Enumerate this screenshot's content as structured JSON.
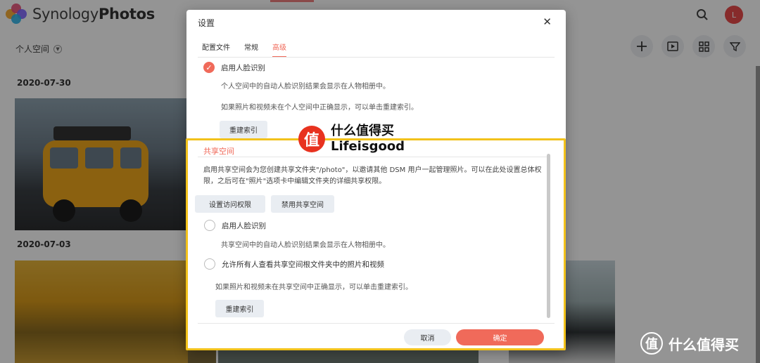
{
  "app": {
    "logo_text_light": "Synology",
    "logo_text_bold": "Photos",
    "space_selector": "个人空间",
    "avatar_letter": "L",
    "dates": [
      "2020-07-30",
      "2020-07-03"
    ],
    "icons": {
      "search": "search-icon",
      "add": "plus-icon",
      "slideshow": "slideshow-icon",
      "grid": "grid-icon",
      "filter": "filter-icon",
      "dropdown": "chevron-down-icon"
    }
  },
  "dialog": {
    "title": "设置",
    "close_glyph": "✕",
    "tabs": [
      {
        "label": "配置文件",
        "active": false
      },
      {
        "label": "常规",
        "active": false
      },
      {
        "label": "高级",
        "active": true
      }
    ],
    "personal": {
      "face_recognition_label": "启用人脸识别",
      "face_recognition_checked": true,
      "face_desc": "个人空间中的自动人脸识别结果会显示在人物相册中。",
      "reindex_desc": "如果照片和视频未在个人空间中正确显示，可以单击重建索引。",
      "reindex_button": "重建索引"
    },
    "shared": {
      "section_title": "共享空间",
      "description": "启用共享空间会为您创建共享文件夹\"/photo\"，以邀请其他 DSM 用户一起管理照片。可以在此处设置总体权限，之后可在\"照片\"选项卡中编辑文件夹的详细共享权限。",
      "access_button": "设置访问权限",
      "disable_button": "禁用共享空间",
      "face_recognition_label": "启用人脸识别",
      "face_recognition_checked": false,
      "face_desc": "共享空间中的自动人脸识别结果会显示在人物相册中。",
      "allow_all_label": "允许所有人查看共享空间根文件夹中的照片和视频",
      "allow_all_checked": false,
      "reindex_desc": "如果照片和视频未在共享空间中正确显示，可以单击重建索引。",
      "reindex_button": "重建索引"
    },
    "cancel_button": "取消",
    "ok_button": "确定"
  },
  "watermark": {
    "seal_glyph": "值",
    "title": "什么值得买",
    "subtitle": "Lifeisgood",
    "corner_text": "什么值得买"
  },
  "colors": {
    "accent": "#f06a5a",
    "highlight": "#f2c21b",
    "avatar": "#e84a4a"
  }
}
